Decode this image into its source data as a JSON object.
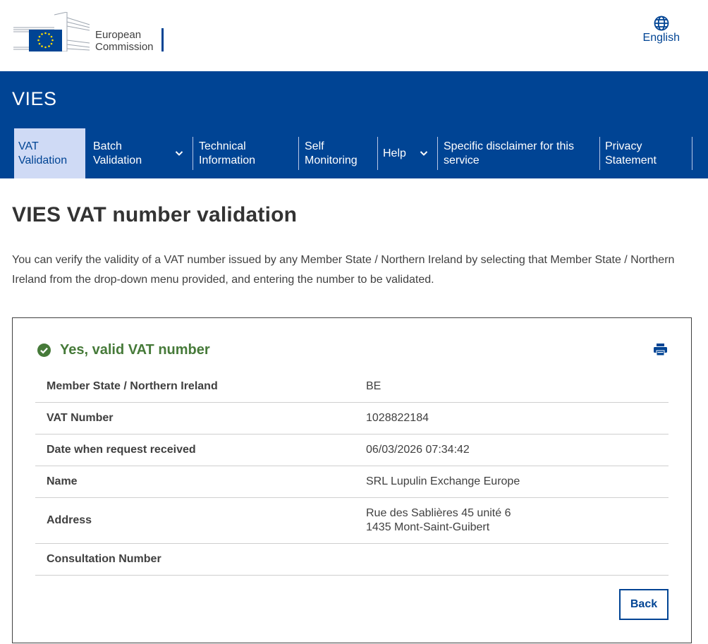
{
  "header": {
    "logo_line1": "European",
    "logo_line2": "Commission",
    "language": "English",
    "brand_blue": "#004494"
  },
  "site": {
    "name": "VIES"
  },
  "nav": {
    "items": [
      {
        "line1": "VAT",
        "line2": "Validation",
        "active": true
      },
      {
        "line1": "Batch",
        "line2": "Validation",
        "dropdown": true
      },
      {
        "line1": "Technical",
        "line2": "Information"
      },
      {
        "line1": "Self",
        "line2": "Monitoring"
      },
      {
        "line1": "Help",
        "line2": "",
        "dropdown": true
      },
      {
        "line1": "Specific disclaimer for this",
        "line2": "service"
      },
      {
        "line1": "Privacy",
        "line2": "Statement"
      }
    ]
  },
  "page": {
    "title": "VIES VAT number validation",
    "intro": "You can verify the validity of a VAT number issued by any Member State / Northern Ireland by selecting that Member State / Northern Ireland from the drop-down menu provided, and entering the number to be validated."
  },
  "result": {
    "status": "Yes, valid VAT number",
    "status_color": "#467a39",
    "rows": [
      {
        "label": "Member State / Northern Ireland",
        "value": "BE"
      },
      {
        "label": "VAT Number",
        "value": "1028822184"
      },
      {
        "label": "Date when request received",
        "value": "06/03/2026 07:34:42"
      },
      {
        "label": "Name",
        "value": "SRL Lupulin Exchange Europe"
      },
      {
        "label": "Address",
        "value_line1": "Rue des Sablières 45 unité 6",
        "value_line2": "1435 Mont-Saint-Guibert"
      },
      {
        "label": "Consultation Number",
        "value": ""
      }
    ],
    "back_label": "Back"
  }
}
